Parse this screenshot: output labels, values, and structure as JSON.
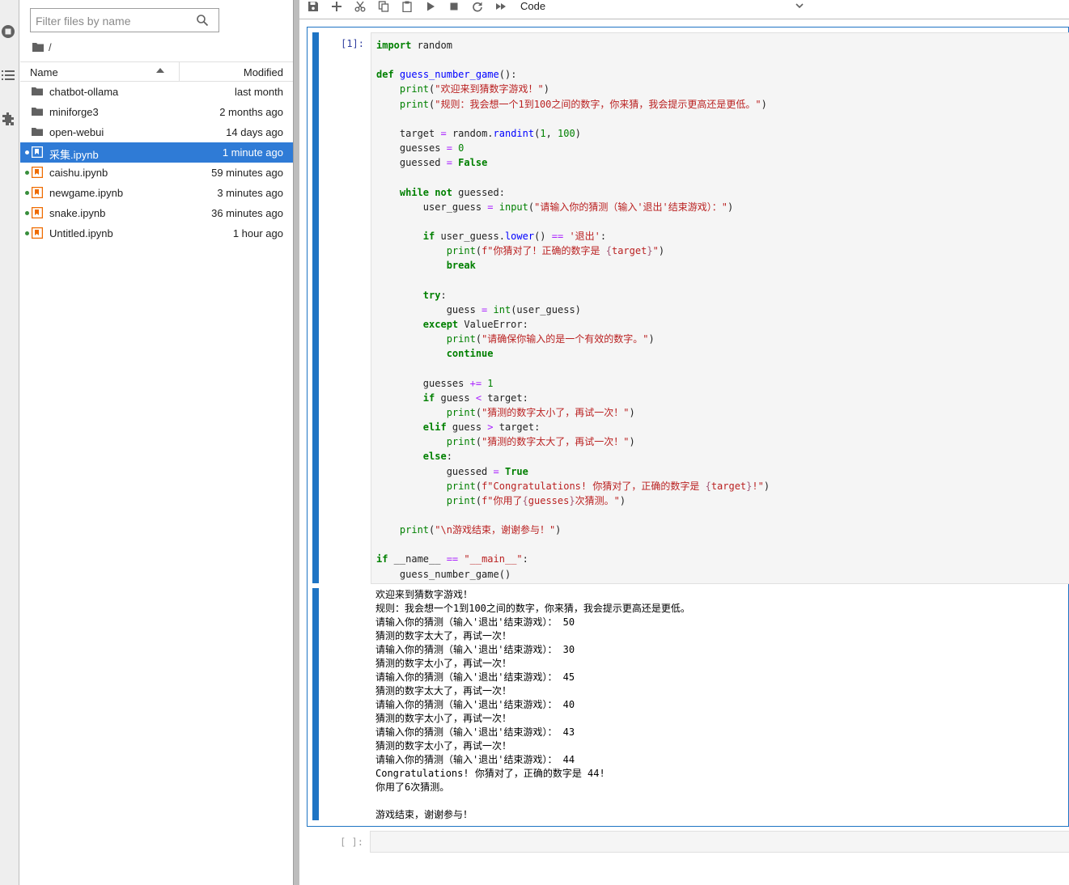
{
  "sidebar": {
    "icons": [
      "running-icon",
      "toc-icon",
      "extension-icon"
    ]
  },
  "filebrowser": {
    "filter_placeholder": "Filter files by name",
    "breadcrumb": "/",
    "columns": {
      "name": "Name",
      "modified": "Modified"
    },
    "files": [
      {
        "name": "chatbot-ollama",
        "modified": "last month",
        "type": "folder",
        "running": false
      },
      {
        "name": "miniforge3",
        "modified": "2 months ago",
        "type": "folder",
        "running": false
      },
      {
        "name": "open-webui",
        "modified": "14 days ago",
        "type": "folder",
        "running": false
      },
      {
        "name": "采集.ipynb",
        "modified": "1 minute ago",
        "type": "notebook",
        "running": true,
        "selected": true
      },
      {
        "name": "caishu.ipynb",
        "modified": "59 minutes ago",
        "type": "notebook",
        "running": true
      },
      {
        "name": "newgame.ipynb",
        "modified": "3 minutes ago",
        "type": "notebook",
        "running": true
      },
      {
        "name": "snake.ipynb",
        "modified": "36 minutes ago",
        "type": "notebook",
        "running": true
      },
      {
        "name": "Untitled.ipynb",
        "modified": "1 hour ago",
        "type": "notebook",
        "running": true
      }
    ]
  },
  "toolbar": {
    "buttons": [
      "save-icon",
      "add-cell-icon",
      "cut-icon",
      "copy-icon",
      "paste-icon",
      "run-icon",
      "stop-icon",
      "restart-icon",
      "fast-forward-icon"
    ],
    "cell_type": "Code"
  },
  "cells": [
    {
      "prompt": "[1]:",
      "code_lines": [
        "import random",
        "",
        "def guess_number_game():",
        "    print(\"欢迎来到猜数字游戏！\")",
        "    print(\"规则：我会想一个1到100之间的数字，你来猜，我会提示更高还是更低。\")",
        "",
        "    target = random.randint(1, 100)",
        "    guesses = 0",
        "    guessed = False",
        "",
        "    while not guessed:",
        "        user_guess = input(\"请输入你的猜测（输入'退出'结束游戏）：\")",
        "",
        "        if user_guess.lower() == '退出':",
        "            print(f\"你猜对了！正确的数字是 {target}\")",
        "            break",
        "",
        "        try:",
        "            guess = int(user_guess)",
        "        except ValueError:",
        "            print(\"请确保你输入的是一个有效的数字。\")",
        "            continue",
        "",
        "        guesses += 1",
        "        if guess < target:",
        "            print(\"猜测的数字太小了，再试一次！\")",
        "        elif guess > target:",
        "            print(\"猜测的数字太大了，再试一次！\")",
        "        else:",
        "            guessed = True",
        "            print(f\"Congratulations! 你猜对了，正确的数字是 {target}!\")",
        "            print(f\"你用了{guesses}次猜测。\")",
        "",
        "    print(\"\\n游戏结束，谢谢参与！\")",
        "",
        "if __name__ == \"__main__\":",
        "    guess_number_game()"
      ],
      "output": "欢迎来到猜数字游戏！\n规则：我会想一个1到100之间的数字，你来猜，我会提示更高还是更低。\n请输入你的猜测（输入'退出'结束游戏）： 50\n猜测的数字太大了，再试一次！\n请输入你的猜测（输入'退出'结束游戏）： 30\n猜测的数字太小了，再试一次！\n请输入你的猜测（输入'退出'结束游戏）： 45\n猜测的数字太大了，再试一次！\n请输入你的猜测（输入'退出'结束游戏）： 40\n猜测的数字太小了，再试一次！\n请输入你的猜测（输入'退出'结束游戏）： 43\n猜测的数字太小了，再试一次！\n请输入你的猜测（输入'退出'结束游戏）： 44\nCongratulations! 你猜对了，正确的数字是 44!\n你用了6次猜测。\n\n游戏结束，谢谢参与！"
    },
    {
      "prompt": "[ ]:",
      "code_lines": []
    }
  ]
}
